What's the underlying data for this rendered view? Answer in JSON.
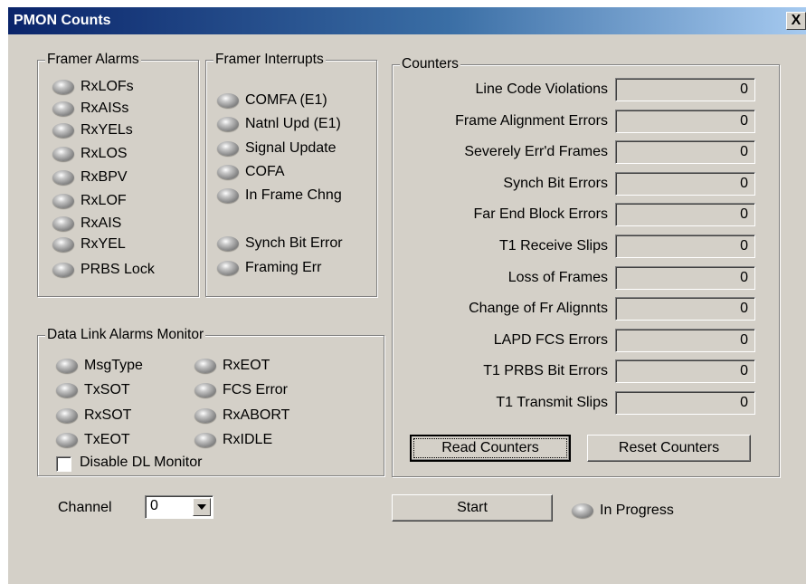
{
  "window": {
    "title": "PMON Counts",
    "close_label": "X"
  },
  "framer_alarms": {
    "title": "Framer Alarms",
    "items": [
      "RxLOFs",
      "RxAISs",
      "RxYELs",
      "RxLOS",
      "RxBPV",
      "RxLOF",
      "RxAIS",
      "RxYEL",
      "PRBS Lock"
    ]
  },
  "framer_interrupts": {
    "title": "Framer Interrupts",
    "items": [
      "COMFA (E1)",
      "Natnl Upd (E1)",
      "Signal Update",
      "COFA",
      "In Frame Chng",
      "Synch Bit Error",
      "Framing Err"
    ]
  },
  "dl_monitor": {
    "title": "Data Link Alarms Monitor",
    "left": [
      "MsgType",
      "TxSOT",
      "RxSOT",
      "TxEOT"
    ],
    "right": [
      "RxEOT",
      "FCS Error",
      "RxABORT",
      "RxIDLE"
    ],
    "disable_label": "Disable DL Monitor",
    "disable_checked": false
  },
  "counters": {
    "title": "Counters",
    "rows": [
      {
        "label": "Line Code Violations",
        "value": "0"
      },
      {
        "label": "Frame Alignment Errors",
        "value": "0"
      },
      {
        "label": "Severely Err'd Frames",
        "value": "0"
      },
      {
        "label": "Synch Bit Errors",
        "value": "0"
      },
      {
        "label": "Far End Block Errors",
        "value": "0"
      },
      {
        "label": "T1 Receive Slips",
        "value": "0"
      },
      {
        "label": "Loss of Frames",
        "value": "0"
      },
      {
        "label": "Change of Fr Alignnts",
        "value": "0"
      },
      {
        "label": "LAPD FCS Errors",
        "value": "0"
      },
      {
        "label": "T1 PRBS Bit Errors",
        "value": "0"
      },
      {
        "label": "T1 Transmit Slips",
        "value": "0"
      }
    ],
    "read_label": "Read Counters",
    "reset_label": "Reset Counters"
  },
  "channel": {
    "label": "Channel",
    "value": "0"
  },
  "start_label": "Start",
  "progress_label": "In Progress",
  "icons": {
    "led": "led-indicator-icon",
    "dropdown": "chevron-down-icon",
    "close": "close-icon"
  },
  "colors": {
    "titlebar_start": "#0a246a",
    "titlebar_end": "#a6caf0",
    "face": "#d4d0c8"
  }
}
